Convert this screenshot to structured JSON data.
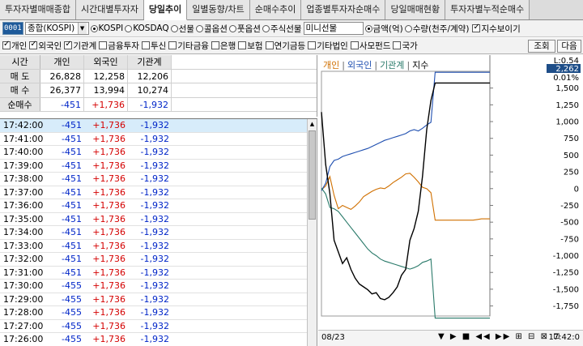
{
  "tabs": [
    "투자자별매매종합",
    "시간대별투자자",
    "당일추이",
    "일별동향/차트",
    "순매수추이",
    "업종별투자자순매수",
    "당일매매현황",
    "투자자별누적순매수"
  ],
  "active_tab": 2,
  "toolbar": {
    "code": "0001",
    "index_name": "종합(KOSPI)",
    "radios1": [
      "KOSPI",
      "KOSDAQ",
      "선물",
      "콜옵션",
      "풋옵션",
      "주식선물"
    ],
    "mini_futures": "미니선물",
    "radios2": [
      "금액(억)",
      "수량(천주/계약)"
    ],
    "index_view_label": "지수보이기"
  },
  "investors": [
    "개인",
    "외국인",
    "기관계",
    "금융투자",
    "투신",
    "기타금융",
    "은행",
    "보험",
    "연기금등",
    "기타법인",
    "사모펀드",
    "국가"
  ],
  "investors_checked": [
    true,
    true,
    true,
    false,
    false,
    false,
    false,
    false,
    false,
    false,
    false,
    false
  ],
  "buttons": {
    "query": "조회",
    "next": "다음"
  },
  "summary": {
    "headers": [
      "시간",
      "개인",
      "외국인",
      "기관계"
    ],
    "rows": [
      {
        "label": "매 도",
        "v": [
          "26,828",
          "12,258",
          "12,206"
        ]
      },
      {
        "label": "매 수",
        "v": [
          "26,377",
          "13,994",
          "10,274"
        ]
      },
      {
        "label": "순매수",
        "v": [
          "-451",
          "+1,736",
          "-1,932"
        ]
      }
    ]
  },
  "timeline": [
    {
      "t": "17:42:00",
      "v": [
        "-451",
        "+1,736",
        "-1,932"
      ]
    },
    {
      "t": "17:41:00",
      "v": [
        "-451",
        "+1,736",
        "-1,932"
      ]
    },
    {
      "t": "17:40:00",
      "v": [
        "-451",
        "+1,736",
        "-1,932"
      ]
    },
    {
      "t": "17:39:00",
      "v": [
        "-451",
        "+1,736",
        "-1,932"
      ]
    },
    {
      "t": "17:38:00",
      "v": [
        "-451",
        "+1,736",
        "-1,932"
      ]
    },
    {
      "t": "17:37:00",
      "v": [
        "-451",
        "+1,736",
        "-1,932"
      ]
    },
    {
      "t": "17:36:00",
      "v": [
        "-451",
        "+1,736",
        "-1,932"
      ]
    },
    {
      "t": "17:35:00",
      "v": [
        "-451",
        "+1,736",
        "-1,932"
      ]
    },
    {
      "t": "17:34:00",
      "v": [
        "-451",
        "+1,736",
        "-1,932"
      ]
    },
    {
      "t": "17:33:00",
      "v": [
        "-451",
        "+1,736",
        "-1,932"
      ]
    },
    {
      "t": "17:32:00",
      "v": [
        "-451",
        "+1,736",
        "-1,932"
      ]
    },
    {
      "t": "17:31:00",
      "v": [
        "-451",
        "+1,736",
        "-1,932"
      ]
    },
    {
      "t": "17:30:00",
      "v": [
        "-455",
        "+1,736",
        "-1,932"
      ]
    },
    {
      "t": "17:29:00",
      "v": [
        "-455",
        "+1,736",
        "-1,932"
      ]
    },
    {
      "t": "17:28:00",
      "v": [
        "-455",
        "+1,736",
        "-1,932"
      ]
    },
    {
      "t": "17:27:00",
      "v": [
        "-455",
        "+1,736",
        "-1,932"
      ]
    },
    {
      "t": "17:26:00",
      "v": [
        "-455",
        "+1,736",
        "-1,932"
      ]
    }
  ],
  "colors": {
    "individual": "#d07000",
    "foreign": "#1f4fb0",
    "institution": "#2a7a6a",
    "index": "#000000",
    "red": "#d40000",
    "blue": "#0025c8"
  },
  "chart_data": {
    "type": "line",
    "legend": [
      "개인",
      "외국인",
      "기관계",
      "지수"
    ],
    "y_ticks": [
      "1,500",
      "1,250",
      "1,000",
      "750",
      "500",
      "250",
      "0",
      "-250",
      "-500",
      "-750",
      "-1,000",
      "-1,250",
      "-1,500",
      "-1,750"
    ],
    "ylim": [
      -1900,
      1750
    ],
    "top_labels": [
      "L:0.54",
      "2,262",
      "0.01%"
    ],
    "x_start": "08/23",
    "x_end": "17:42:0",
    "series": [
      {
        "name": "개인",
        "values": [
          -20,
          40,
          180,
          -100,
          -300,
          -250,
          -280,
          -310,
          -260,
          -200,
          -120,
          -80,
          -40,
          -10,
          10,
          0,
          40,
          90,
          130,
          170,
          220,
          230,
          170,
          100,
          20,
          0,
          -60,
          -470,
          -470,
          -470,
          -470,
          -470,
          -470,
          -470,
          -470,
          -470,
          -470,
          -460,
          -451,
          -451,
          -451
        ]
      },
      {
        "name": "외국인",
        "values": [
          -30,
          80,
          330,
          420,
          440,
          480,
          500,
          520,
          540,
          560,
          580,
          600,
          630,
          660,
          690,
          720,
          740,
          760,
          780,
          800,
          820,
          860,
          880,
          860,
          900,
          950,
          990,
          1736,
          1736,
          1736,
          1736,
          1736,
          1736,
          1736,
          1736,
          1736,
          1736,
          1736,
          1736,
          1736,
          1736
        ]
      },
      {
        "name": "기관계",
        "values": [
          10,
          -80,
          -280,
          -300,
          -340,
          -420,
          -500,
          -580,
          -660,
          -740,
          -820,
          -900,
          -960,
          -1000,
          -1050,
          -1080,
          -1100,
          -1120,
          -1140,
          -1160,
          -1180,
          -1200,
          -1180,
          -1150,
          -1100,
          -1080,
          -1050,
          -1932,
          -1932,
          -1932,
          -1932,
          -1932,
          -1932,
          -1932,
          -1932,
          -1932,
          -1932,
          -1932,
          -1932,
          -1932,
          -1932
        ]
      },
      {
        "name": "지수",
        "values": [
          1.5,
          0.6,
          0.1,
          -0.7,
          -0.9,
          -1.1,
          -1.0,
          -1.2,
          -1.35,
          -1.45,
          -1.5,
          -1.55,
          -1.62,
          -1.6,
          -1.7,
          -1.72,
          -1.68,
          -1.6,
          -1.5,
          -1.3,
          -1.2,
          -0.7,
          -0.5,
          -0.2,
          0.4,
          1.2,
          1.7,
          2.0,
          2.0,
          2.0,
          2.0,
          2.0,
          2.0,
          2.0,
          2.0,
          2.0,
          2.0,
          2.0,
          2.0,
          2.0,
          2.0
        ]
      }
    ]
  }
}
